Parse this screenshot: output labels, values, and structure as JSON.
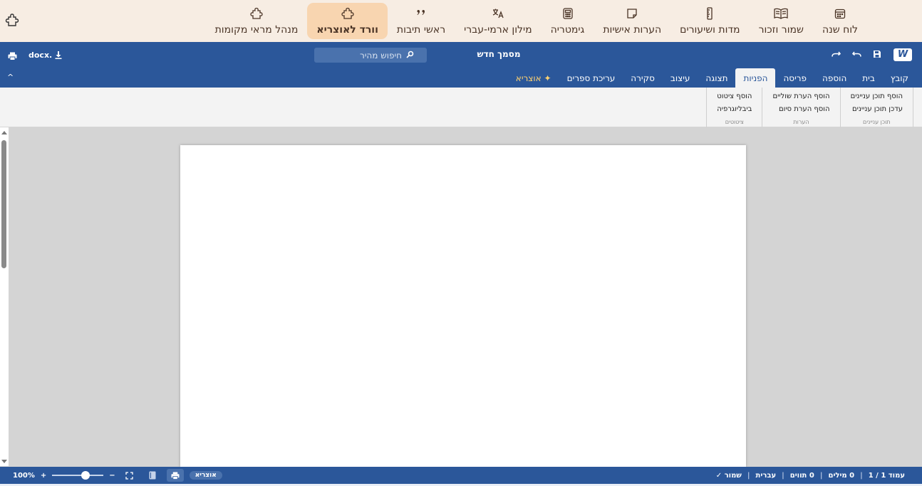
{
  "nav": {
    "items": [
      {
        "label": "לוח שנה",
        "icon": "calendar-icon"
      },
      {
        "label": "שמור וזכור",
        "icon": "open-book-icon"
      },
      {
        "label": "מדות ושיעורים",
        "icon": "ruler-icon"
      },
      {
        "label": "הערות אישיות",
        "icon": "sticky-note-icon"
      },
      {
        "label": "גימטריה",
        "icon": "calculator-icon"
      },
      {
        "label": "מילון ארמי-עברי",
        "icon": "translate-icon"
      },
      {
        "label": "ראשי תיבות",
        "icon": "quote-icon"
      },
      {
        "label": "וורד לאוצריא",
        "icon": "puzzle-icon",
        "active": true
      },
      {
        "label": "מנהל מראי מקומות",
        "icon": "puzzle-icon"
      }
    ],
    "settings_icon": "puzzle-settings-icon",
    "active_bg": "#f8d5b0",
    "bg": "#f7ede3"
  },
  "header": {
    "logo": "W",
    "title": "מסמך חדש",
    "search_placeholder": "חיפוש מהיר",
    "export_label": "docx.",
    "accent": "#2b579a"
  },
  "tabs": [
    {
      "label": "קובץ"
    },
    {
      "label": "בית"
    },
    {
      "label": "הוספה"
    },
    {
      "label": "פריסה"
    },
    {
      "label": "הפניות",
      "active": true
    },
    {
      "label": "תצוגה"
    },
    {
      "label": "עיצוב"
    },
    {
      "label": "סקירה"
    },
    {
      "label": "עריכת ספרים"
    },
    {
      "label": "✦ אוצריא",
      "special": true
    }
  ],
  "collapse_label": "^",
  "ribbon": {
    "groups": [
      {
        "label": "תוכן עניינים",
        "buttons": [
          "הוסף תוכן עניינים",
          "עדכן תוכן עניינים"
        ]
      },
      {
        "label": "הערות",
        "buttons": [
          "הוסף הערת שוליים",
          "הוסף הערת סיום"
        ]
      },
      {
        "label": "ציטוטים",
        "buttons": [
          "הוסף ציטוט",
          "ביבליוגרפיה"
        ]
      }
    ]
  },
  "status": {
    "page": "עמוד 1 / 1",
    "words": "0 מילים",
    "chars": "0 תווים",
    "language": "עברית",
    "saved": "שמור ✓",
    "otzaria": "אוצריא",
    "zoom": "100%",
    "zoom_level": 0.65,
    "zoom_plus": "+",
    "zoom_minus": "−"
  }
}
